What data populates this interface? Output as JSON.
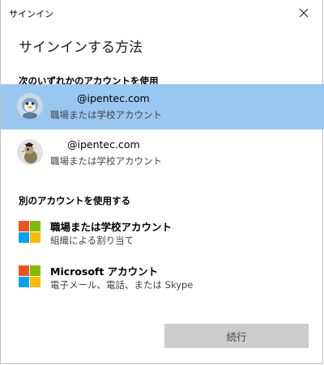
{
  "window": {
    "title": "サインイン",
    "close_icon": "close-icon"
  },
  "heading": "サインインする方法",
  "section_existing": "次のいずれかのアカウントを使用",
  "accounts": [
    {
      "primary": "@ipentec.com",
      "secondary": "職場または学校アカウント",
      "avatar": "penguin-avatar-icon",
      "selected": true
    },
    {
      "primary": "@ipentec.com",
      "secondary": "職場または学校アカウント",
      "avatar": "bird-avatar-icon",
      "selected": false
    }
  ],
  "section_other": "別のアカウントを使用する",
  "options": [
    {
      "primary": "職場または学校アカウント",
      "secondary": "組織による割り当て",
      "icon": "microsoft-logo-icon"
    },
    {
      "primary": "Microsoft アカウント",
      "secondary": "電子メール、電話、または Skype",
      "icon": "microsoft-logo-icon"
    }
  ],
  "continue_label": "続行",
  "colors": {
    "selected_bg": "#99c7f0",
    "ms_red": "#f25022",
    "ms_green": "#7fba00",
    "ms_blue": "#00a4ef",
    "ms_yellow": "#ffb900",
    "button_bg": "#cccccc"
  }
}
